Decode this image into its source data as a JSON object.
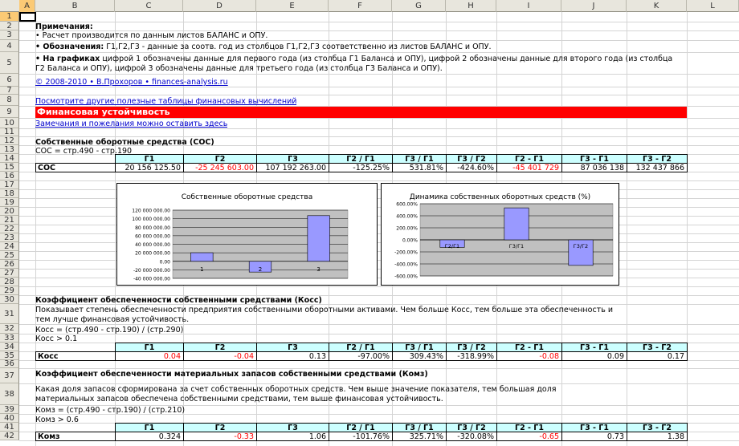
{
  "columns": [
    "A",
    "B",
    "C",
    "D",
    "E",
    "F",
    "G",
    "H",
    "I",
    "J",
    "K",
    "L"
  ],
  "rows": [
    "1",
    "2",
    "3",
    "4",
    "5",
    "6",
    "7",
    "8",
    "9",
    "10",
    "11",
    "12",
    "13",
    "14",
    "15",
    "16",
    "17",
    "18",
    "19",
    "20",
    "21",
    "22",
    "23",
    "24",
    "25",
    "26",
    "27",
    "28",
    "29",
    "30",
    "31",
    "32",
    "33",
    "34",
    "35",
    "36",
    "37",
    "38",
    "39",
    "40",
    "41",
    "42"
  ],
  "notes": {
    "title": "Примечания:",
    "line1": "• Расчет производится по данным листов БАЛАНС и ОПУ.",
    "line2_bold": "• Обозначения:",
    "line2_rest": " Г1,Г2,Г3 - данные за соотв. год из столбцов Г1,Г2,Г3 соответственно из листов БАЛАНС и ОПУ.",
    "line3_bold": "• На графиках",
    "line3_rest": " цифрой 1 обозначены данные для первого года (из столбца Г1 Баланса и ОПУ), цифрой 2 обозначены данные для второго года (из столбца",
    "line3_cont": "Г2 Баланса и ОПУ), цифрой 3 обозначены данные для третьего года (из столбца Г3 Баланса и ОПУ).",
    "copyright": "© 2008-2010 • В.Прохоров • finances-analysis.ru",
    "link_other": "Посмотрите другие полезные таблицы финансовых вычислений",
    "banner": "Финансовая устойчивость",
    "link_feedback": "Замечания и пожелания можно оставить здесь"
  },
  "sos": {
    "heading": "Собственные оборотные средства (СОС)",
    "formula": "СОС = стр.490 - стр.190",
    "headers": [
      "Г1",
      "Г2",
      "Г3",
      "Г2 / Г1",
      "Г3 / Г1",
      "Г3 / Г2",
      "Г2 - Г1",
      "Г3 - Г1",
      "Г3 - Г2"
    ],
    "label": "СОС",
    "values": [
      "20 156 125.50",
      "-25 245 603.00",
      "107 192 263.00",
      "-125.25%",
      "531.81%",
      "-424.60%",
      "-45 401 729",
      "87 036 138",
      "132 437 866"
    ]
  },
  "koss": {
    "heading": "Коэффициент обеспеченности собственными средствами (Косс)",
    "desc1": "Показывает степень обеспеченности предприятия собственными оборотными активами. Чем больше Косс, тем больше эта обеспеченность и",
    "desc2": "тем лучше финансовая устойчивость.",
    "formula": "Косс = (стр.490 - стр.190) / (стр.290)",
    "norm": "Косс > 0.1",
    "headers": [
      "Г1",
      "Г2",
      "Г3",
      "Г2 / Г1",
      "Г3 / Г1",
      "Г3 / Г2",
      "Г2 - Г1",
      "Г3 - Г1",
      "Г3 - Г2"
    ],
    "label": "Косс",
    "values": [
      "0.04",
      "-0.04",
      "0.13",
      "-97.00%",
      "309.43%",
      "-318.99%",
      "-0.08",
      "0.09",
      "0.17"
    ]
  },
  "komz": {
    "heading": "Коэффициент обеспеченности материальных запасов собственными средствами (Комз)",
    "desc1": "Какая доля запасов сформирована за счет собственных оборотных средств. Чем выше значение показателя, тем большая доля",
    "desc2": "материальных запасов обеспечена собственными средствами, тем выше финансовая устойчивость.",
    "formula": "Комз = (стр.490 - стр.190) / (стр.210)",
    "norm": "Комз > 0.6",
    "headers": [
      "Г1",
      "Г2",
      "Г3",
      "Г2 / Г1",
      "Г3 / Г1",
      "Г3 / Г2",
      "Г2 - Г1",
      "Г3 - Г1",
      "Г3 - Г2"
    ],
    "label": "Комз",
    "values": [
      "0.324",
      "-0.33",
      "1.06",
      "-101.76%",
      "325.71%",
      "-320.08%",
      "-0.65",
      "0.73",
      "1.38"
    ]
  },
  "chart_data": [
    {
      "type": "bar",
      "title": "Собственные оборотные средства",
      "categories": [
        "1",
        "2",
        "3"
      ],
      "values": [
        20156125.5,
        -25245603,
        107192263
      ],
      "ylim": [
        -40000000,
        120000000
      ],
      "yticks": [
        "120 000 000.00",
        "100 000 000.00",
        "80 000 000.00",
        "60 000 000.00",
        "40 000 000.00",
        "20 000 000.00",
        "0.00",
        "-20 000 000.00",
        "-40 000 000.00"
      ],
      "bar_color": "#9999ff",
      "grid": true
    },
    {
      "type": "bar",
      "title": "Динамика собственных оборотных средств (%)",
      "categories": [
        "Г2/Г1",
        "Г3/Г1",
        "Г3/Г2"
      ],
      "values": [
        -125.25,
        531.81,
        -424.6
      ],
      "ylim": [
        -600,
        600
      ],
      "yticks": [
        "600.00%",
        "400.00%",
        "200.00%",
        "0.00%",
        "-200.00%",
        "-400.00%",
        "-600.00%"
      ],
      "bar_color": "#9999ff",
      "grid": true
    }
  ]
}
